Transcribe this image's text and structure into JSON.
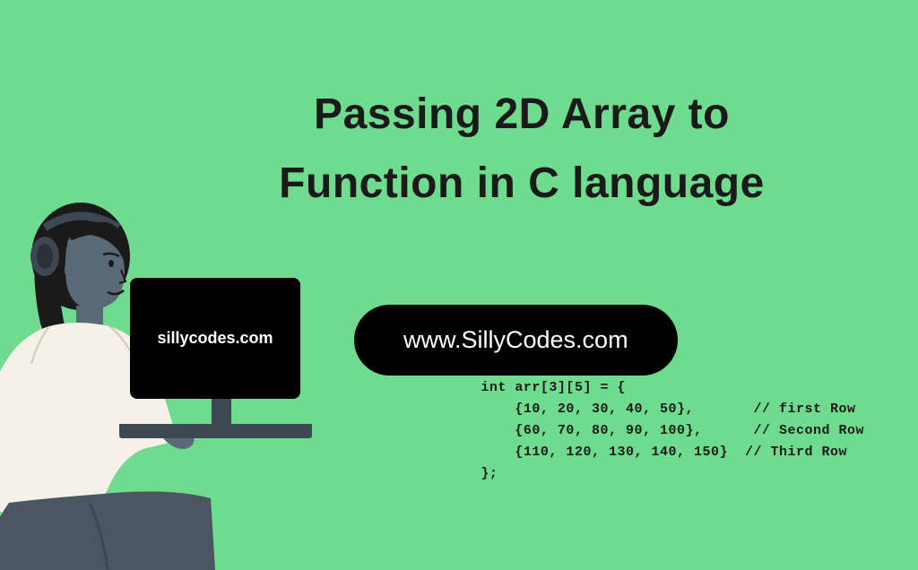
{
  "title": {
    "line1": "Passing 2D Array to",
    "line2": "Function in C  language"
  },
  "monitor": {
    "text": "sillycodes.com"
  },
  "url_pill": "www.SillyCodes.com",
  "code": {
    "line1": "int arr[3][5] = {",
    "line2": "    {10, 20, 30, 40, 50},       // first Row",
    "line3": "    {60, 70, 80, 90, 100},      // Second Row",
    "line4": "    {110, 120, 130, 140, 150}  // Third Row",
    "line5": "};"
  }
}
